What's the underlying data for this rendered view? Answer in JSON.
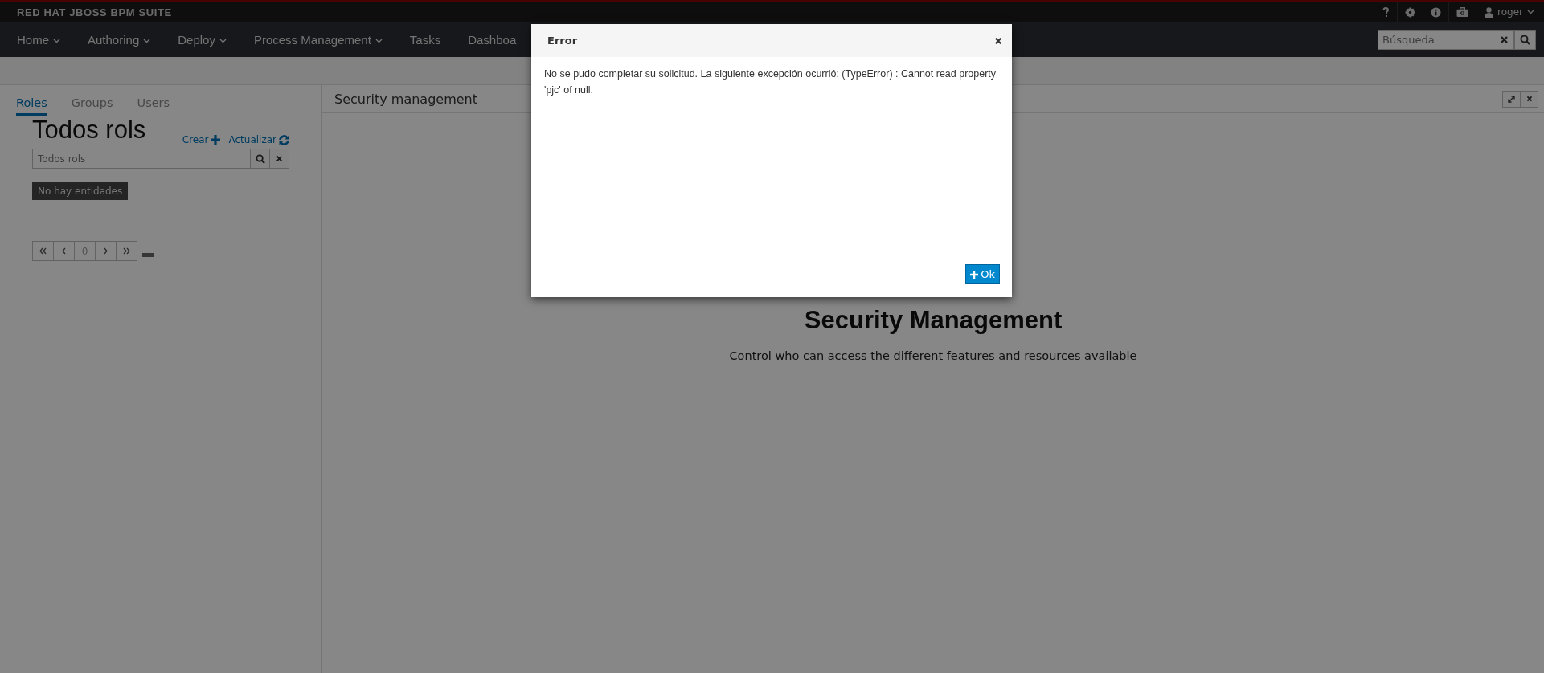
{
  "brand": {
    "title": "RED HAT JBOSS BPM SUITE"
  },
  "utility_menu": {
    "icons": [
      {
        "kind": "help"
      },
      {
        "kind": "settings"
      },
      {
        "kind": "info"
      },
      {
        "kind": "case"
      }
    ],
    "user": "roger"
  },
  "nav": {
    "items": [
      {
        "label": "Home",
        "dropdown": true
      },
      {
        "label": "Authoring",
        "dropdown": true
      },
      {
        "label": "Deploy",
        "dropdown": true
      },
      {
        "label": "Process Management",
        "dropdown": true
      },
      {
        "label": "Tasks",
        "dropdown": false
      },
      {
        "label": "Dashboa",
        "dropdown": false
      }
    ],
    "search": {
      "placeholder": "Búsqueda"
    }
  },
  "left_panel": {
    "tabs": [
      {
        "label": "Roles",
        "selected": true
      },
      {
        "label": "Groups",
        "selected": false
      },
      {
        "label": "Users",
        "selected": false
      }
    ],
    "title": "Todos rols",
    "actions": [
      {
        "label": "Crear",
        "kind": "create"
      },
      {
        "label": "Actualizar",
        "kind": "refresh"
      }
    ],
    "search": {
      "placeholder": "Todos rols"
    },
    "empty_label": "No hay entidades",
    "pager": {
      "page": "0"
    }
  },
  "right_panel": {
    "title": "Security management",
    "heading": "Security Management",
    "subtitle": "Control who can access the different features and resources available"
  },
  "dialog": {
    "title": "Error",
    "message": "No se pudo completar su solicitud. La siguiente excepción ocurrió: (TypeError) : Cannot read property 'pjc' of null.",
    "button": "Ok"
  }
}
